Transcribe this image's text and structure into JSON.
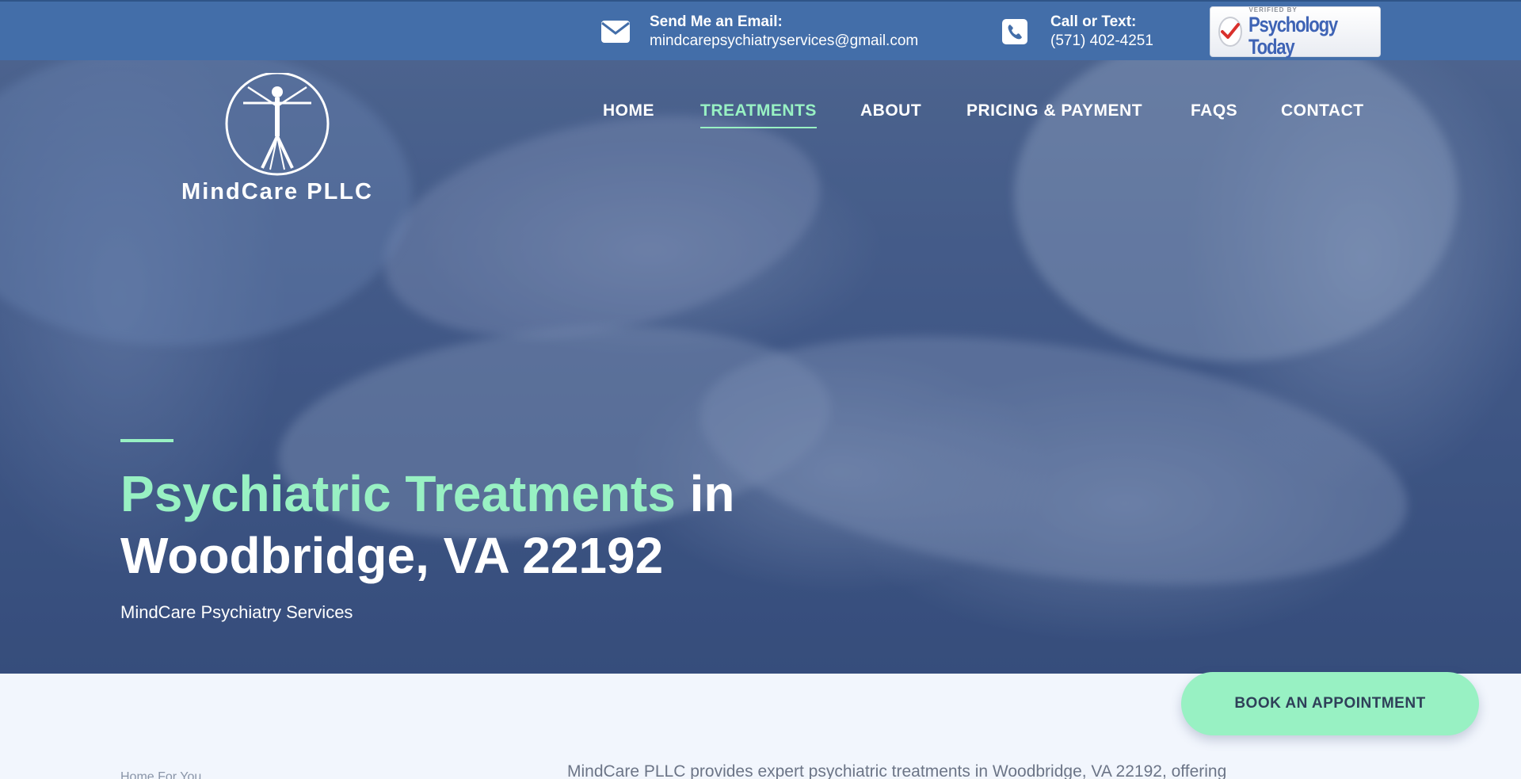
{
  "topbar": {
    "email_label": "Send Me an Email:",
    "email_value": "mindcarepsychiatryservices@gmail.com",
    "email_icon": "envelope-icon",
    "phone_label": "Call or Text:",
    "phone_value": "(571) 402-4251",
    "phone_icon": "phone-icon",
    "badge_verified": "VERIFIED BY",
    "badge_brand": "Psychology Today"
  },
  "logo": {
    "name": "MindCare PLLC",
    "icon": "vitruvian-man-logo-icon"
  },
  "nav": {
    "items": [
      {
        "label": "HOME",
        "active": false
      },
      {
        "label": "TREATMENTS",
        "active": true
      },
      {
        "label": "ABOUT",
        "active": false
      },
      {
        "label": "PRICING & PAYMENT",
        "active": false
      },
      {
        "label": "FAQS",
        "active": false
      },
      {
        "label": "CONTACT",
        "active": false
      }
    ]
  },
  "hero": {
    "title_highlight": "Psychiatric Treatments",
    "title_rest_line1": " in",
    "title_line2": "Woodbridge, VA 22192",
    "subtitle": "MindCare Psychiatry Services"
  },
  "cta": {
    "book_label": "BOOK AN APPOINTMENT"
  },
  "below": {
    "left_partial": "Home   For You",
    "intro_partial": "MindCare PLLC provides expert psychiatric treatments in Woodbridge, VA 22192, offering"
  },
  "colors": {
    "topbar": "#436ea9",
    "accent": "#98f1c3",
    "page_bg": "#f2f6fd",
    "button_text": "#2f4059"
  }
}
